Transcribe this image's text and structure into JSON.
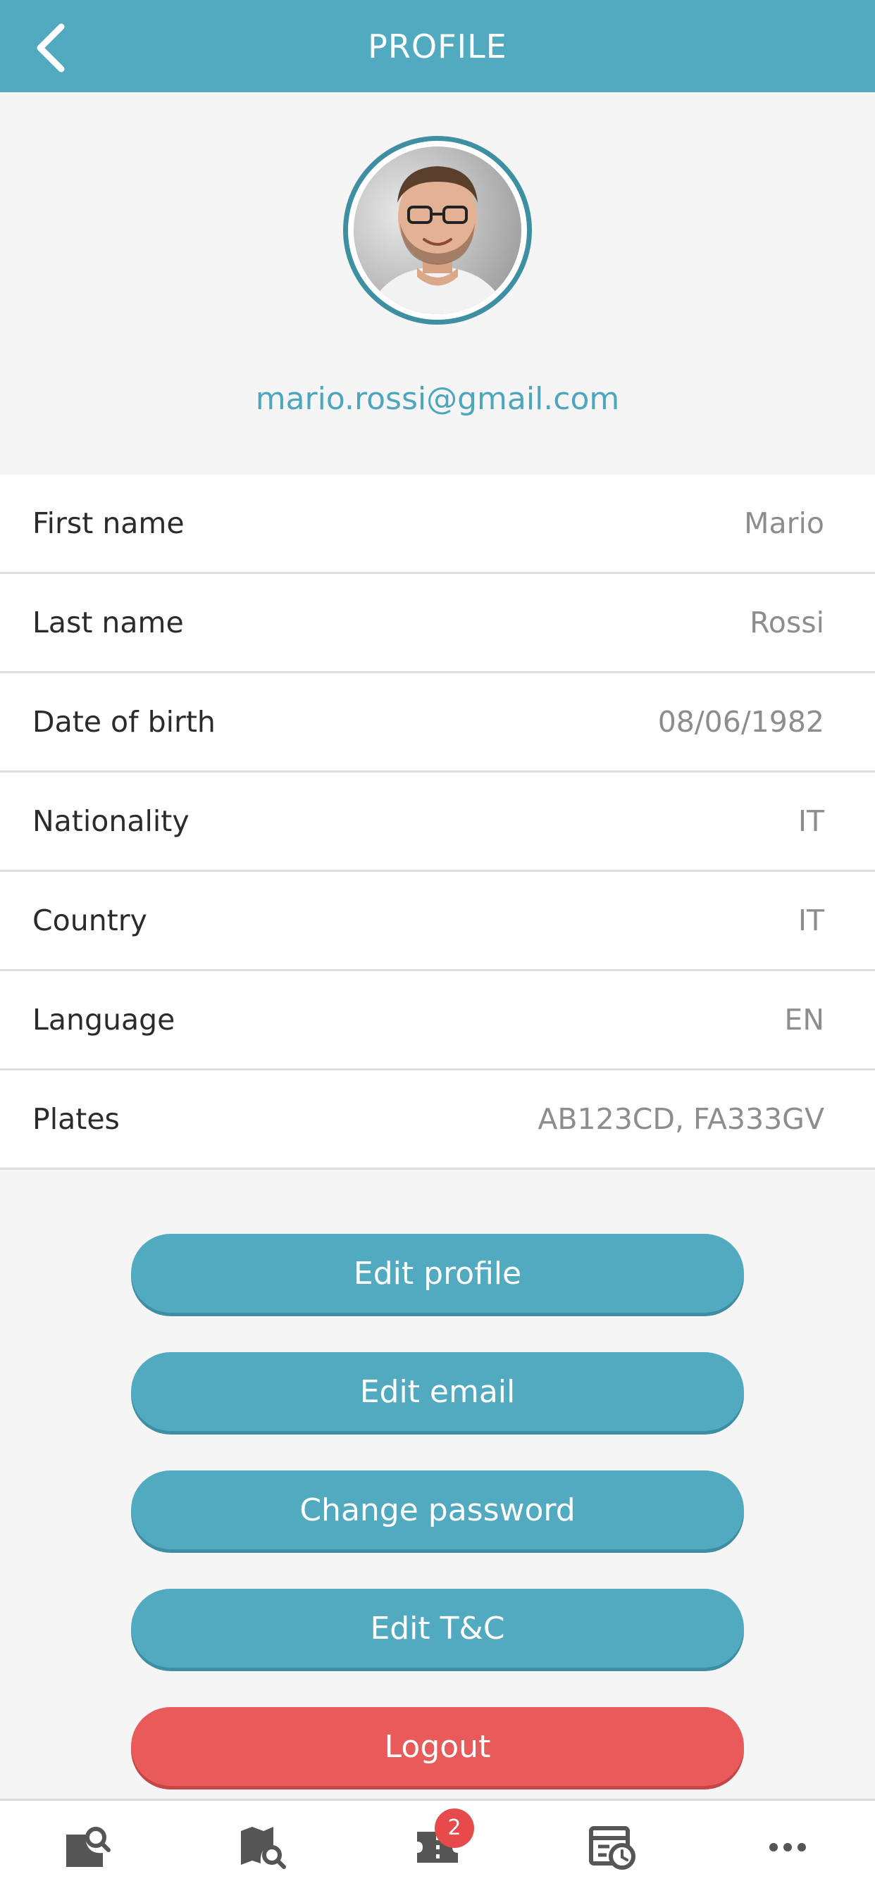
{
  "header": {
    "title": "PROFILE",
    "back_icon": "chevron-left-icon"
  },
  "profile": {
    "email": "mario.rossi@gmail.com"
  },
  "fields": [
    {
      "label": "First name",
      "value": "Mario"
    },
    {
      "label": "Last name",
      "value": "Rossi"
    },
    {
      "label": "Date of birth",
      "value": "08/06/1982"
    },
    {
      "label": "Nationality",
      "value": "IT"
    },
    {
      "label": "Country",
      "value": "IT"
    },
    {
      "label": "Language",
      "value": "EN"
    },
    {
      "label": "Plates",
      "value": "AB123CD, FA333GV"
    }
  ],
  "buttons": {
    "edit_profile": "Edit profile",
    "edit_email": "Edit email",
    "change_password": "Change password",
    "edit_tc": "Edit T&C",
    "logout": "Logout"
  },
  "bottom_nav": {
    "items": [
      "search-document-icon",
      "map-search-icon",
      "ticket-icon",
      "calendar-clock-icon",
      "more-icon"
    ],
    "ticket_badge": "2"
  },
  "colors": {
    "accent": "#52aac1",
    "danger": "#e95a5a",
    "email": "#4ea6bd"
  }
}
